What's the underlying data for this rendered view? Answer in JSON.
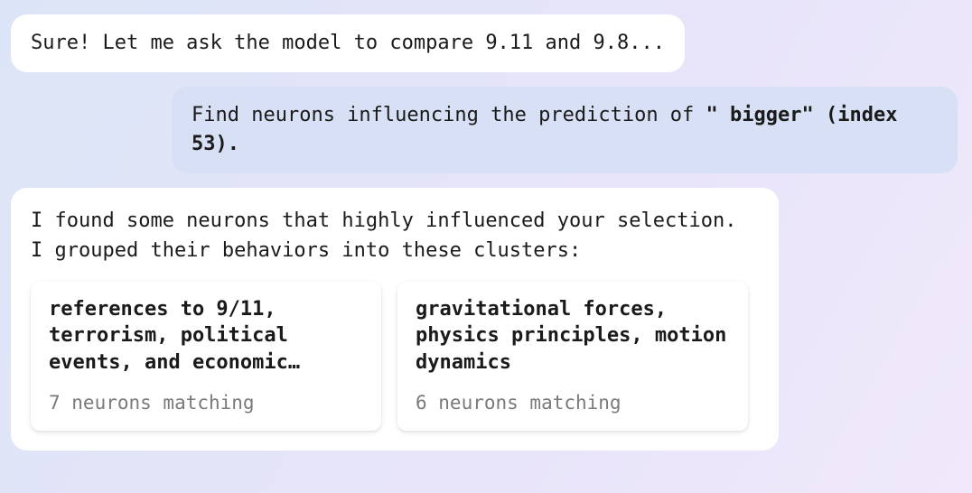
{
  "messages": {
    "assistant_top": "Sure! Let me ask the model to compare 9.11 and 9.8...",
    "user_prefix": "Find neurons influencing the prediction of ",
    "user_bold": "\" bigger\" (index 53).",
    "assistant_intro": "I found some neurons that highly influenced your selection. I grouped their behaviors into these clusters:"
  },
  "clusters": [
    {
      "title": "references to 9/11, terrorism, political events, and economic…",
      "matching_count": 7,
      "matching_label": "7 neurons matching"
    },
    {
      "title": "gravitational forces, physics principles, motion dynamics",
      "matching_count": 6,
      "matching_label": "6 neurons matching"
    }
  ]
}
